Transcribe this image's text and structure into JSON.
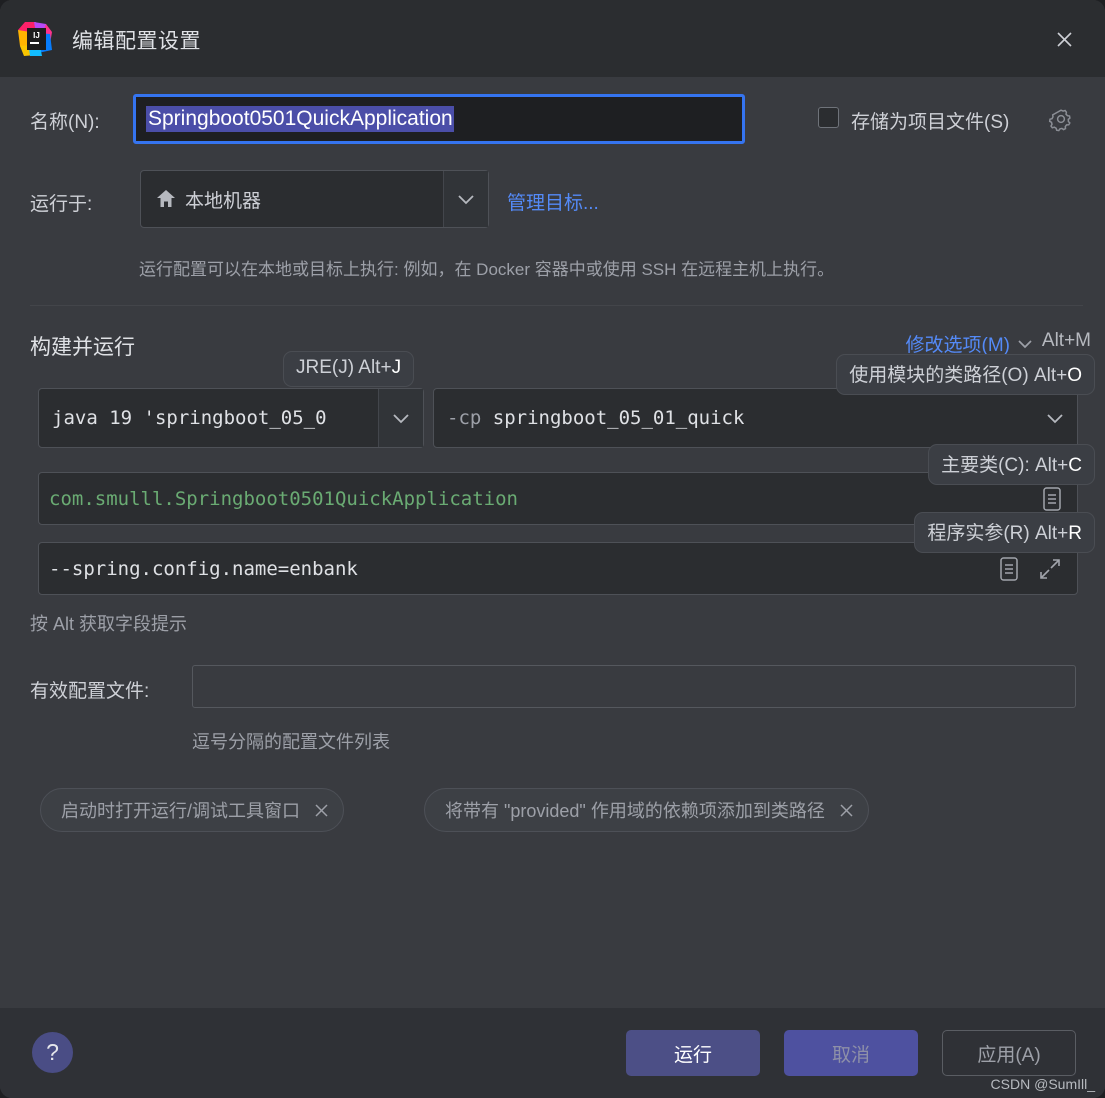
{
  "window": {
    "title": "编辑配置设置",
    "app_icon": "intellij-idea-logo",
    "close_icon": "close-icon"
  },
  "name_row": {
    "label": "名称(N):",
    "value": "Springboot0501QuickApplication",
    "store_as_project_file_label": "存储为项目文件(S)",
    "store_as_project_file_checked": false,
    "gear_icon": "gear-icon"
  },
  "run_on": {
    "label": "运行于:",
    "value": "本地机器",
    "value_icon": "home-icon",
    "manage_targets_link": "管理目标...",
    "description": "运行配置可以在本地或目标上执行: 例如，在 Docker 容器中或使用 SSH 在远程主机上执行。"
  },
  "build_and_run": {
    "section_title": "构建并运行",
    "modify_options_label": "修改选项(M)",
    "modify_options_shortcut": "Alt+M",
    "jre_value": "java 19 'springboot_05_0",
    "classpath_flag": "-cp",
    "classpath_value": "springboot_05_01_quick",
    "main_class_value": "com.smulll.Springboot0501QuickApplication",
    "program_args_value": "--spring.config.name=enbank",
    "alt_hint": "按 Alt 获取字段提示"
  },
  "tooltips": {
    "jre": {
      "text": "JRE(J) Alt+",
      "key": "J"
    },
    "module_classpath": {
      "text": "使用模块的类路径(O) Alt+",
      "key": "O"
    },
    "main_class": {
      "text": "主要类(C): Alt+",
      "key": "C"
    },
    "program_args": {
      "text": "程序实参(R) Alt+",
      "key": "R"
    }
  },
  "active_profiles": {
    "label": "有效配置文件:",
    "value": "",
    "hint": "逗号分隔的配置文件列表"
  },
  "option_chips": [
    {
      "label": "启动时打开运行/调试工具窗口",
      "remove_icon": "close-icon"
    },
    {
      "label": "将带有 \"provided\" 作用域的依赖项添加到类路径",
      "remove_icon": "close-icon"
    }
  ],
  "footer": {
    "help_label": "?",
    "run_label": "运行",
    "cancel_label": "取消",
    "apply_label": "应用(A)"
  },
  "watermark": "CSDN @SumIll_",
  "colors": {
    "dialog_bg": "#393b40",
    "titlebar_bg": "#2b2d30",
    "accent_focus": "#3574f0",
    "selection": "#4b4ea8",
    "link": "#548af7",
    "code_green": "#6aab73",
    "primary_button": "#4c4f86"
  }
}
